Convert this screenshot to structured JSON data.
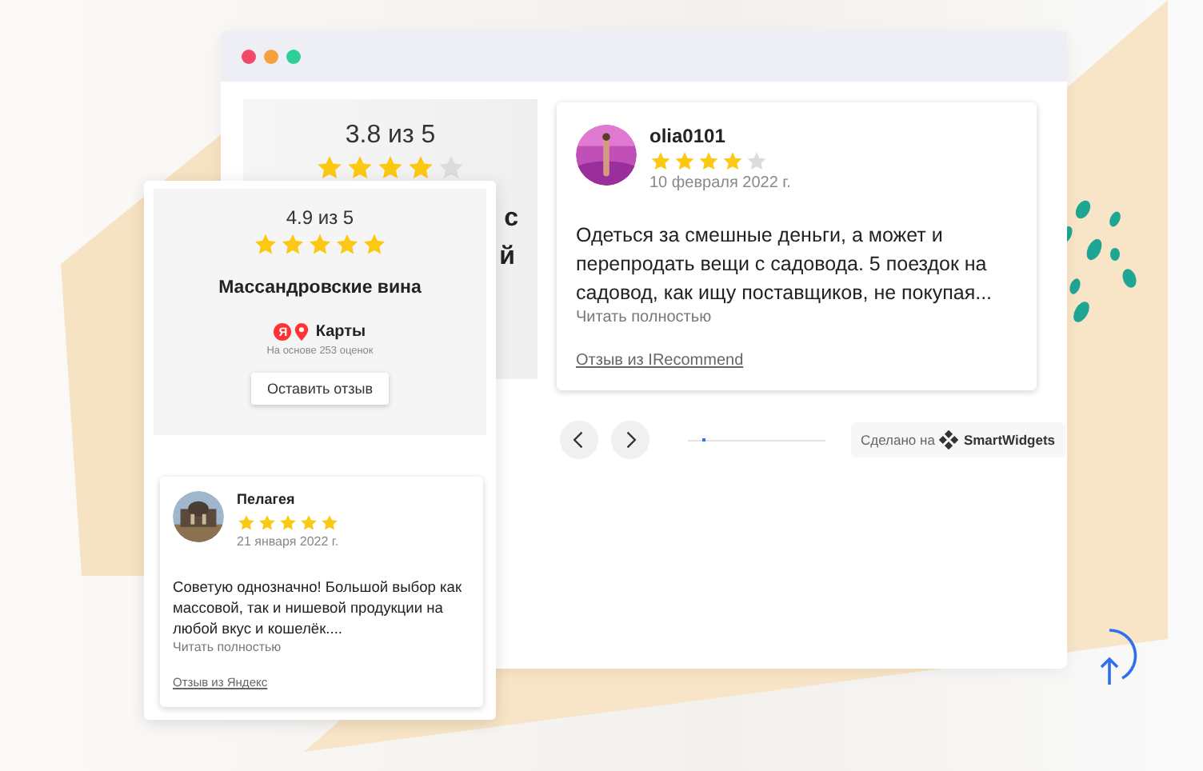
{
  "back_widget": {
    "summary": {
      "rating": "3.8 из 5",
      "stars": 4,
      "title_fragments": [
        "с",
        "й"
      ]
    },
    "review": {
      "author": "olia0101",
      "stars": 4,
      "date": "10 февраля 2022 г.",
      "text": "Одеться за смешные деньги, а может и перепродать вещи с садовода. 5 поездок на садовод, как ищу поставщиков, не покупая...",
      "read_more": "Читать полностью",
      "source": "Отзыв из IRecommend"
    },
    "pager": {
      "level": 0.13
    },
    "badge": {
      "prefix": "Сделано на",
      "brand": "SmartWidgets"
    }
  },
  "front_widget": {
    "summary": {
      "rating": "4.9 из 5",
      "stars": 5,
      "name": "Массандровские вина",
      "platform_badge": "Я",
      "platform": "Карты",
      "based_on": "На основе 253 оценок",
      "button": "Оставить отзыв"
    },
    "review": {
      "author": "Пелагея",
      "stars": 5,
      "date": "21 января 2022 г.",
      "text": "Советую однозначно! Большой выбор как массовой, так и нишевой продукции на любой вкус и кошелёк....",
      "read_more": "Читать полностью",
      "source": "Отзыв из Яндекс"
    }
  }
}
